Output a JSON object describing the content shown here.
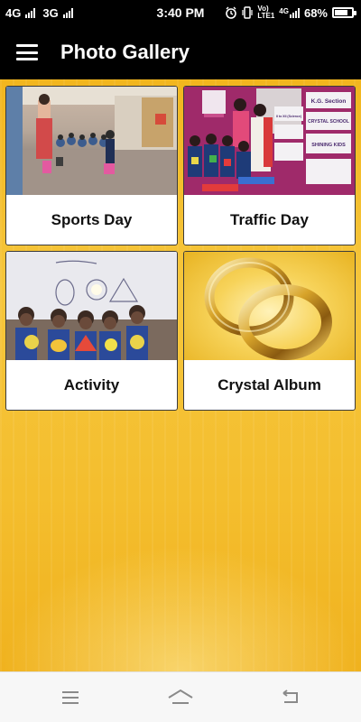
{
  "status_bar": {
    "network_1": "4G",
    "network_2": "3G",
    "time": "3:40 PM",
    "volte": "Vo)",
    "lte": "LTE1",
    "network_3": "4G",
    "battery": "68%",
    "battery_level": 0.68
  },
  "app_bar": {
    "title": "Photo Gallery",
    "menu_icon": "hamburger-menu-icon"
  },
  "gallery": {
    "items": [
      {
        "label": "Sports Day",
        "thumbnail": "classroom-activity-photo"
      },
      {
        "label": "Traffic Day",
        "thumbnail": "students-with-traffic-signs-photo"
      },
      {
        "label": "Activity",
        "thumbnail": "students-with-shape-crafts-photo"
      },
      {
        "label": "Crystal Album",
        "thumbnail": "gold-rings-photo"
      }
    ]
  },
  "photo_text": {
    "sign_1": "K.G. Section",
    "sign_2": "CRYSTAL SCHOOL",
    "sign_3": "II to XII (Science)",
    "sign_4": "SHINING KIDS"
  },
  "nav_bar": {
    "menu_icon": "recent-apps-icon",
    "home_icon": "home-icon",
    "back_icon": "back-icon"
  },
  "colors": {
    "app_bar": "#000000",
    "background_gold": "#f4be2e",
    "card": "#ffffff",
    "nav_bar": "#f7f7f7"
  }
}
